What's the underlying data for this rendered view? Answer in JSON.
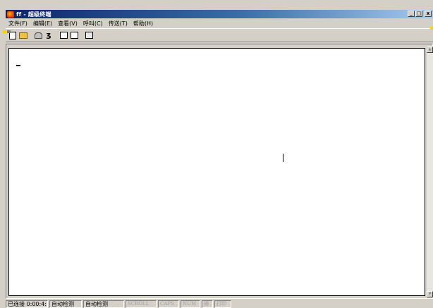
{
  "window": {
    "title": "ff - 超级终端",
    "buttons": {
      "minimize": "_",
      "maximize": "□",
      "close": "x"
    }
  },
  "menu": [
    "文件(F)",
    "编辑(E)",
    "查看(V)",
    "呼叫(C)",
    "传送(T)",
    "帮助(H)"
  ],
  "toolbar": [
    {
      "name": "new-icon"
    },
    {
      "name": "open-folder-icon"
    },
    {
      "name": "call-phone-icon"
    },
    {
      "name": "disconnect-icon"
    },
    {
      "name": "send-file-icon"
    },
    {
      "name": "receive-file-icon"
    },
    {
      "name": "properties-icon"
    }
  ],
  "terminal": {
    "cursor_char": "_"
  },
  "status": {
    "connected": "已连接 0:00:4:",
    "detect1": "自动检测",
    "detect2": "自动检测",
    "scroll": "SCROLL",
    "caps": "CAPS",
    "num": "NUM",
    "capture": "捕",
    "echo": "打印"
  }
}
